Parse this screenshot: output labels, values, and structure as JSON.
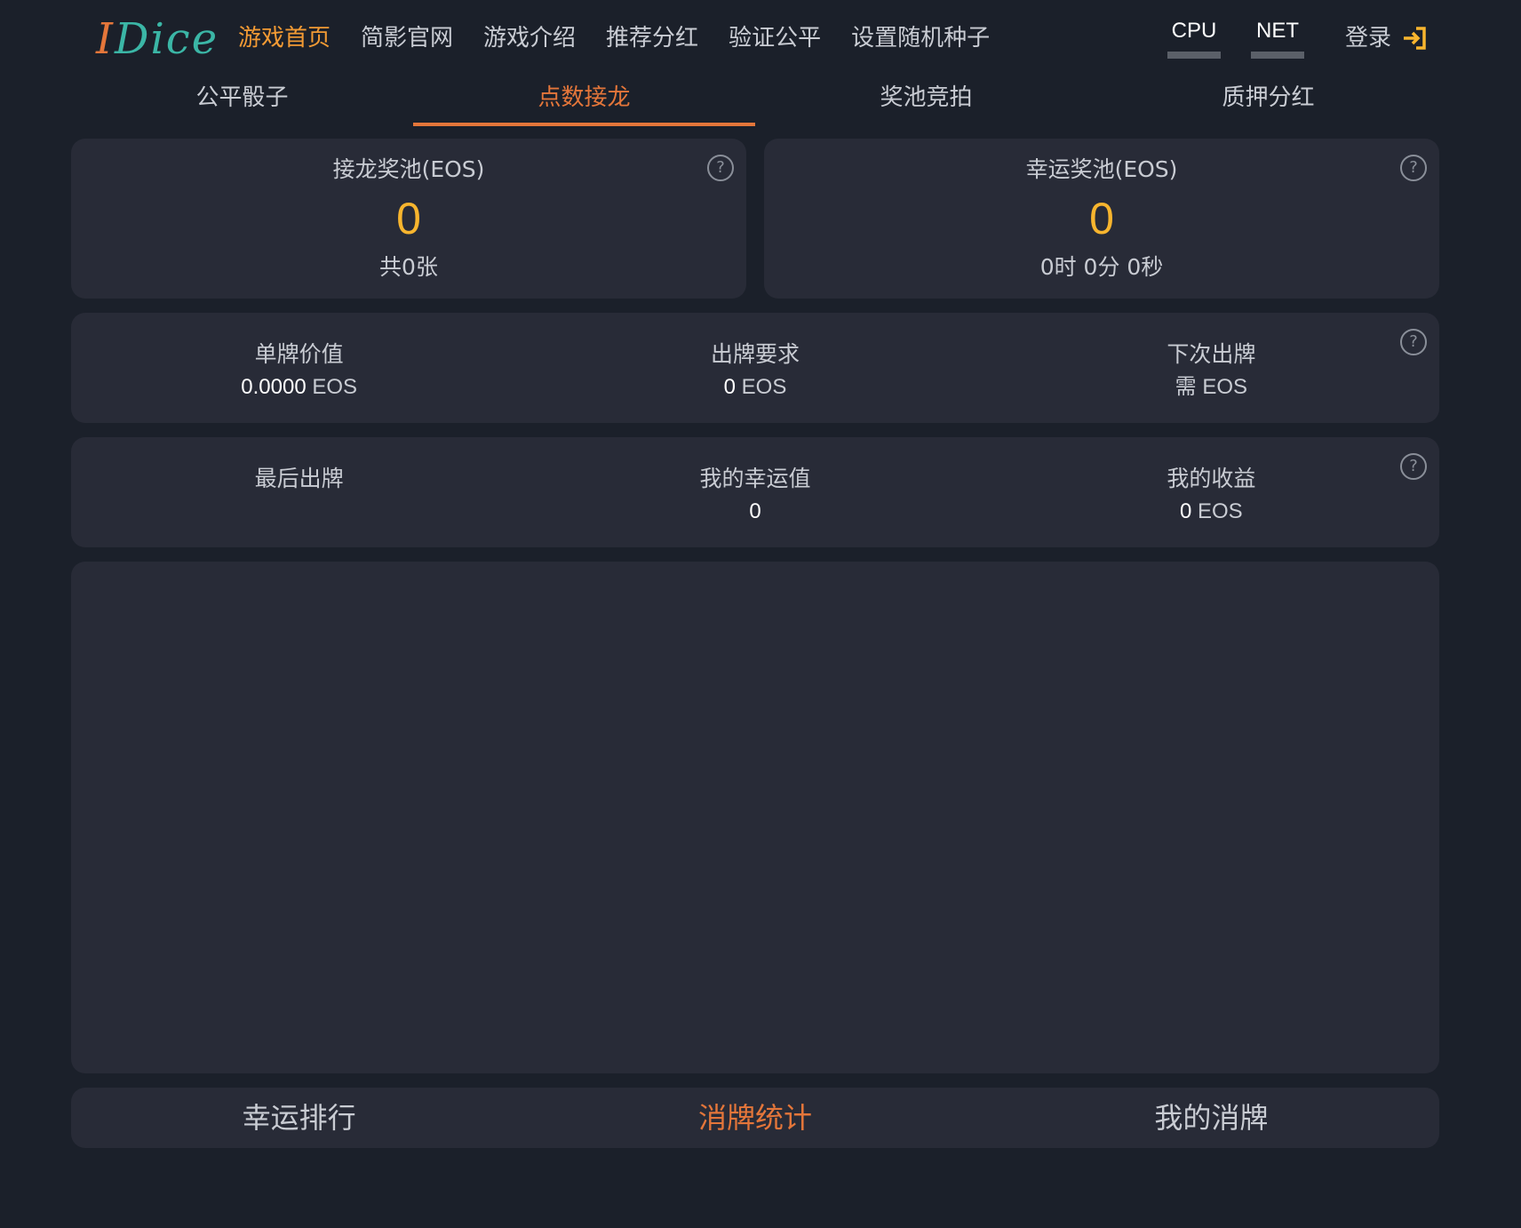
{
  "header": {
    "logo": {
      "part1": "I",
      "part2": "Dice"
    },
    "nav": [
      {
        "label": "游戏首页",
        "active": true
      },
      {
        "label": "简影官网"
      },
      {
        "label": "游戏介绍"
      },
      {
        "label": "推荐分红"
      },
      {
        "label": "验证公平"
      },
      {
        "label": "设置随机种子"
      }
    ],
    "resources": {
      "cpu_label": "CPU",
      "net_label": "NET"
    },
    "login_label": "登录",
    "login_icon": "login-arrow-icon"
  },
  "tabs": [
    {
      "label": "公平骰子"
    },
    {
      "label": "点数接龙",
      "active": true
    },
    {
      "label": "奖池竞拍"
    },
    {
      "label": "质押分红"
    }
  ],
  "pools": {
    "chain_pool": {
      "title": "接龙奖池(EOS)",
      "value": "0",
      "sub": "共0张"
    },
    "lucky_pool": {
      "title": "幸运奖池(EOS)",
      "value": "0",
      "sub": "0时 0分 0秒"
    }
  },
  "card_stats": {
    "card_value": {
      "label": "单牌价值",
      "num": "0.0000",
      "unit": "EOS"
    },
    "play_requirement": {
      "label": "出牌要求",
      "num": "0",
      "unit": "EOS"
    },
    "next_play": {
      "label": "下次出牌",
      "num": "需",
      "unit": "EOS"
    }
  },
  "my_stats": {
    "last_play": {
      "label": "最后出牌",
      "num": ""
    },
    "my_luck": {
      "label": "我的幸运值",
      "num": "0"
    },
    "my_earnings": {
      "label": "我的收益",
      "num": "0",
      "unit": "EOS"
    }
  },
  "help_glyph": "?",
  "bottom_tabs": [
    {
      "label": "幸运排行"
    },
    {
      "label": "消牌统计",
      "active": true
    },
    {
      "label": "我的消牌"
    }
  ],
  "colors": {
    "accent_orange": "#e4763a",
    "nav_active": "#f29a34",
    "pool_value": "#f8b52e",
    "background": "#1b202a",
    "panel": "#282b37"
  }
}
